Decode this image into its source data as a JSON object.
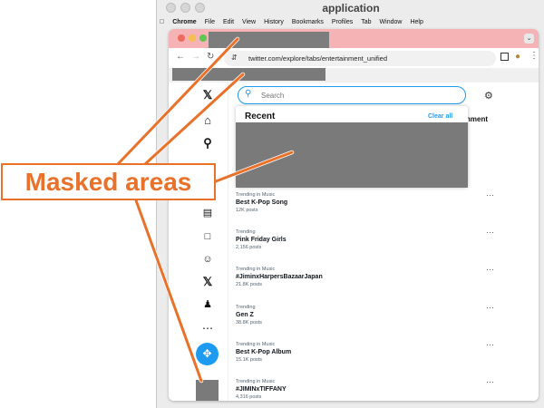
{
  "outer_window": {
    "title": "application"
  },
  "menubar": {
    "items": [
      "Chrome",
      "File",
      "Edit",
      "View",
      "History",
      "Bookmarks",
      "Profiles",
      "Tab",
      "Window",
      "Help"
    ]
  },
  "browser": {
    "url": "twitter.com/explore/tabs/entertainment_unified"
  },
  "search": {
    "placeholder": "Search"
  },
  "dropdown": {
    "heading": "Recent",
    "clear_label": "Clear all"
  },
  "tabs": {
    "active_partial": "nment"
  },
  "trends": [
    {
      "category": "Trending in Music",
      "name": "Best K-Pop Song",
      "posts": "12K posts"
    },
    {
      "category": "Trending",
      "name": "Pink Friday Girls",
      "posts": "2,156 posts"
    },
    {
      "category": "Trending in Music",
      "name": "#JiminxHarpersBazaarJapan",
      "posts": "21.8K posts"
    },
    {
      "category": "Trending",
      "name": "Gen Z",
      "posts": "38.8K posts"
    },
    {
      "category": "Trending in Music",
      "name": "Best K-Pop Album",
      "posts": "15.1K posts"
    },
    {
      "category": "Trending in Music",
      "name": "#JIMINxTIFFANY",
      "posts": "4,316 posts"
    }
  ],
  "annotation": {
    "label": "Masked areas",
    "color": "#e9712a"
  },
  "colors": {
    "tab_strip": "#f5b3b6",
    "accent": "#1d9bf0",
    "mask": "#7a7a7a"
  },
  "icons": [
    "x-logo-icon",
    "home-icon",
    "search-icon",
    "lists-icon",
    "bookmarks-icon",
    "communities-icon",
    "premium-x-icon",
    "profile-icon",
    "more-icon",
    "post-icon",
    "gear-icon"
  ]
}
